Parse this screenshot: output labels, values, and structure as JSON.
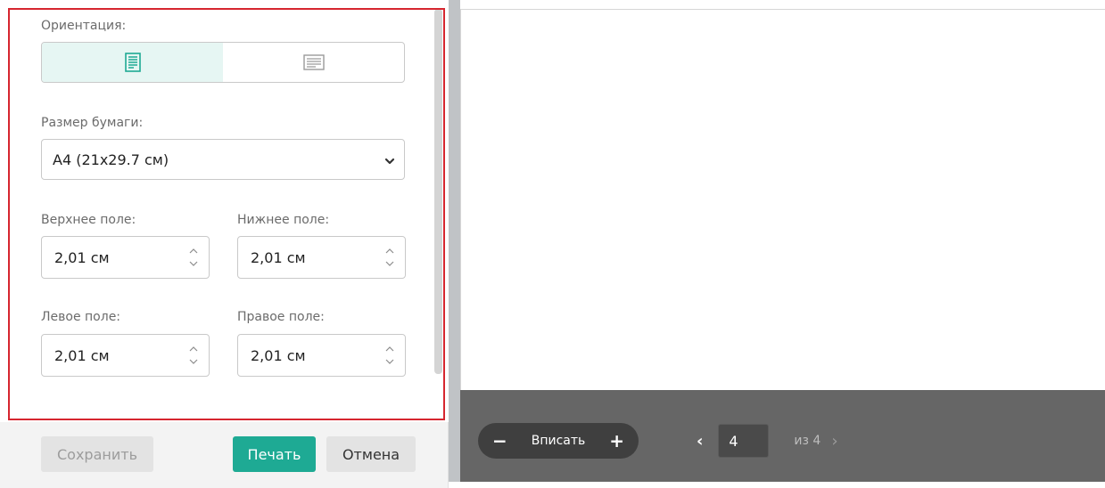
{
  "settings": {
    "orientation_label": "Ориентация:",
    "orientation_options": [
      "portrait",
      "landscape"
    ],
    "orientation_selected": "portrait",
    "paper_size_label": "Размер бумаги:",
    "paper_size_value": "А4 (21x29.7 см)",
    "top_margin_label": "Верхнее поле:",
    "top_margin_value": "2,01 см",
    "bottom_margin_label": "Нижнее поле:",
    "bottom_margin_value": "2,01 см",
    "left_margin_label": "Левое поле:",
    "left_margin_value": "2,01 см",
    "right_margin_label": "Правое поле:",
    "right_margin_value": "2,01 см"
  },
  "footer": {
    "save_label": "Сохранить",
    "print_label": "Печать",
    "cancel_label": "Отмена"
  },
  "preview": {
    "zoom_minus": "−",
    "zoom_label": "Вписать",
    "zoom_plus": "+",
    "prev_icon": "‹",
    "current_page": "4",
    "page_of": "из 4",
    "next_icon": "›"
  },
  "colors": {
    "accent": "#1eaa94",
    "highlight_border": "#d6262f",
    "toolbar_bg": "#666666"
  }
}
